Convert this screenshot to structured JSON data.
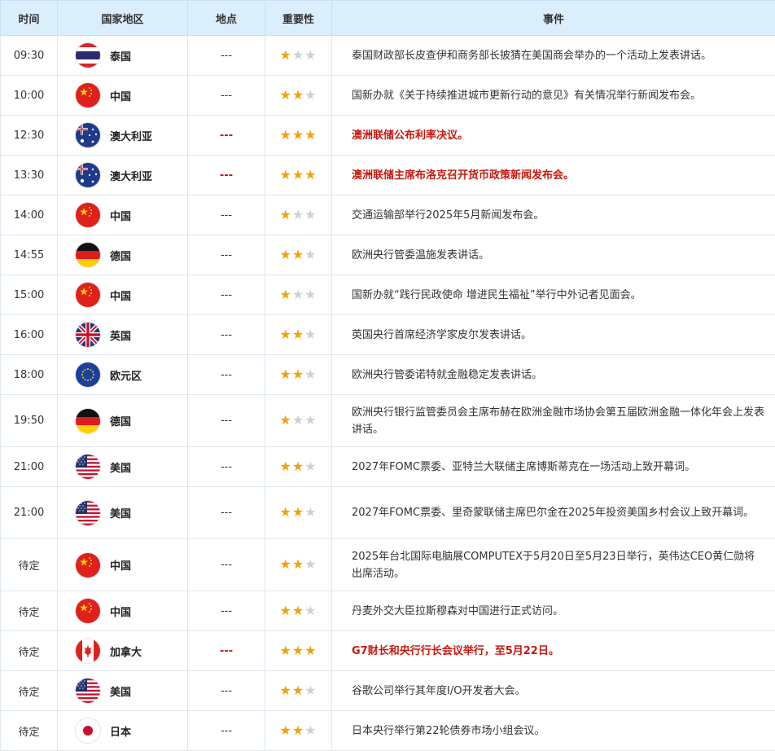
{
  "headers": {
    "time": "时间",
    "country": "国家地区",
    "location": "地点",
    "importance": "重要性",
    "event": "事件"
  },
  "rows": [
    {
      "time": "09:30",
      "flag": "th",
      "country": "泰国",
      "location": "---",
      "stars": 1,
      "highlight": false,
      "event": "泰国财政部长皮查伊和商务部长披猜在美国商会举办的一个活动上发表讲话。"
    },
    {
      "time": "10:00",
      "flag": "cn",
      "country": "中国",
      "location": "---",
      "stars": 2,
      "highlight": false,
      "event": "国新办就《关于持续推进城市更新行动的意见》有关情况举行新闻发布会。"
    },
    {
      "time": "12:30",
      "flag": "au",
      "country": "澳大利亚",
      "location": "---",
      "stars": 3,
      "highlight": true,
      "event": "澳洲联储公布利率决议。"
    },
    {
      "time": "13:30",
      "flag": "au",
      "country": "澳大利亚",
      "location": "---",
      "stars": 3,
      "highlight": true,
      "event": "澳洲联储主席布洛克召开货币政策新闻发布会。"
    },
    {
      "time": "14:00",
      "flag": "cn",
      "country": "中国",
      "location": "---",
      "stars": 1,
      "highlight": false,
      "event": "交通运输部举行2025年5月新闻发布会。"
    },
    {
      "time": "14:55",
      "flag": "de",
      "country": "德国",
      "location": "---",
      "stars": 2,
      "highlight": false,
      "event": "欧洲央行管委温施发表讲话。"
    },
    {
      "time": "15:00",
      "flag": "cn",
      "country": "中国",
      "location": "---",
      "stars": 1,
      "highlight": false,
      "event": "国新办就“践行民政使命 增进民生福祉”举行中外记者见面会。"
    },
    {
      "time": "16:00",
      "flag": "gb",
      "country": "英国",
      "location": "---",
      "stars": 2,
      "highlight": false,
      "event": "英国央行首席经济学家皮尔发表讲话。"
    },
    {
      "time": "18:00",
      "flag": "eu",
      "country": "欧元区",
      "location": "---",
      "stars": 2,
      "highlight": false,
      "event": "欧洲央行管委诺特就金融稳定发表讲话。"
    },
    {
      "time": "19:50",
      "flag": "de",
      "country": "德国",
      "location": "---",
      "stars": 1,
      "highlight": false,
      "tall": true,
      "event": "欧洲央行银行监管委员会主席布赫在欧洲金融市场协会第五届欧洲金融一体化年会上发表讲话。"
    },
    {
      "time": "21:00",
      "flag": "us",
      "country": "美国",
      "location": "---",
      "stars": 2,
      "highlight": false,
      "event": "2027年FOMC票委、亚特兰大联储主席博斯蒂克在一场活动上致开幕词。"
    },
    {
      "time": "21:00",
      "flag": "us",
      "country": "美国",
      "location": "---",
      "stars": 2,
      "highlight": false,
      "tall": true,
      "event": "2027年FOMC票委、里奇蒙联储主席巴尔金在2025年投资美国乡村会议上致开幕词。"
    },
    {
      "time": "待定",
      "flag": "cn",
      "country": "中国",
      "location": "---",
      "stars": 2,
      "highlight": false,
      "tall": true,
      "event": "2025年台北国际电脑展COMPUTEX于5月20日至5月23日举行，英伟达CEO黄仁勋将出席活动。"
    },
    {
      "time": "待定",
      "flag": "cn",
      "country": "中国",
      "location": "---",
      "stars": 2,
      "highlight": false,
      "event": "丹麦外交大臣拉斯穆森对中国进行正式访问。"
    },
    {
      "time": "待定",
      "flag": "ca",
      "country": "加拿大",
      "location": "---",
      "stars": 3,
      "highlight": true,
      "event": "G7财长和央行行长会议举行，至5月22日。"
    },
    {
      "time": "待定",
      "flag": "us",
      "country": "美国",
      "location": "---",
      "stars": 2,
      "highlight": false,
      "event": "谷歌公司举行其年度I/O开发者大会。"
    },
    {
      "time": "待定",
      "flag": "jp",
      "country": "日本",
      "location": "---",
      "stars": 2,
      "highlight": false,
      "event": "日本央行举行第22轮债券市场小组会议。"
    }
  ]
}
